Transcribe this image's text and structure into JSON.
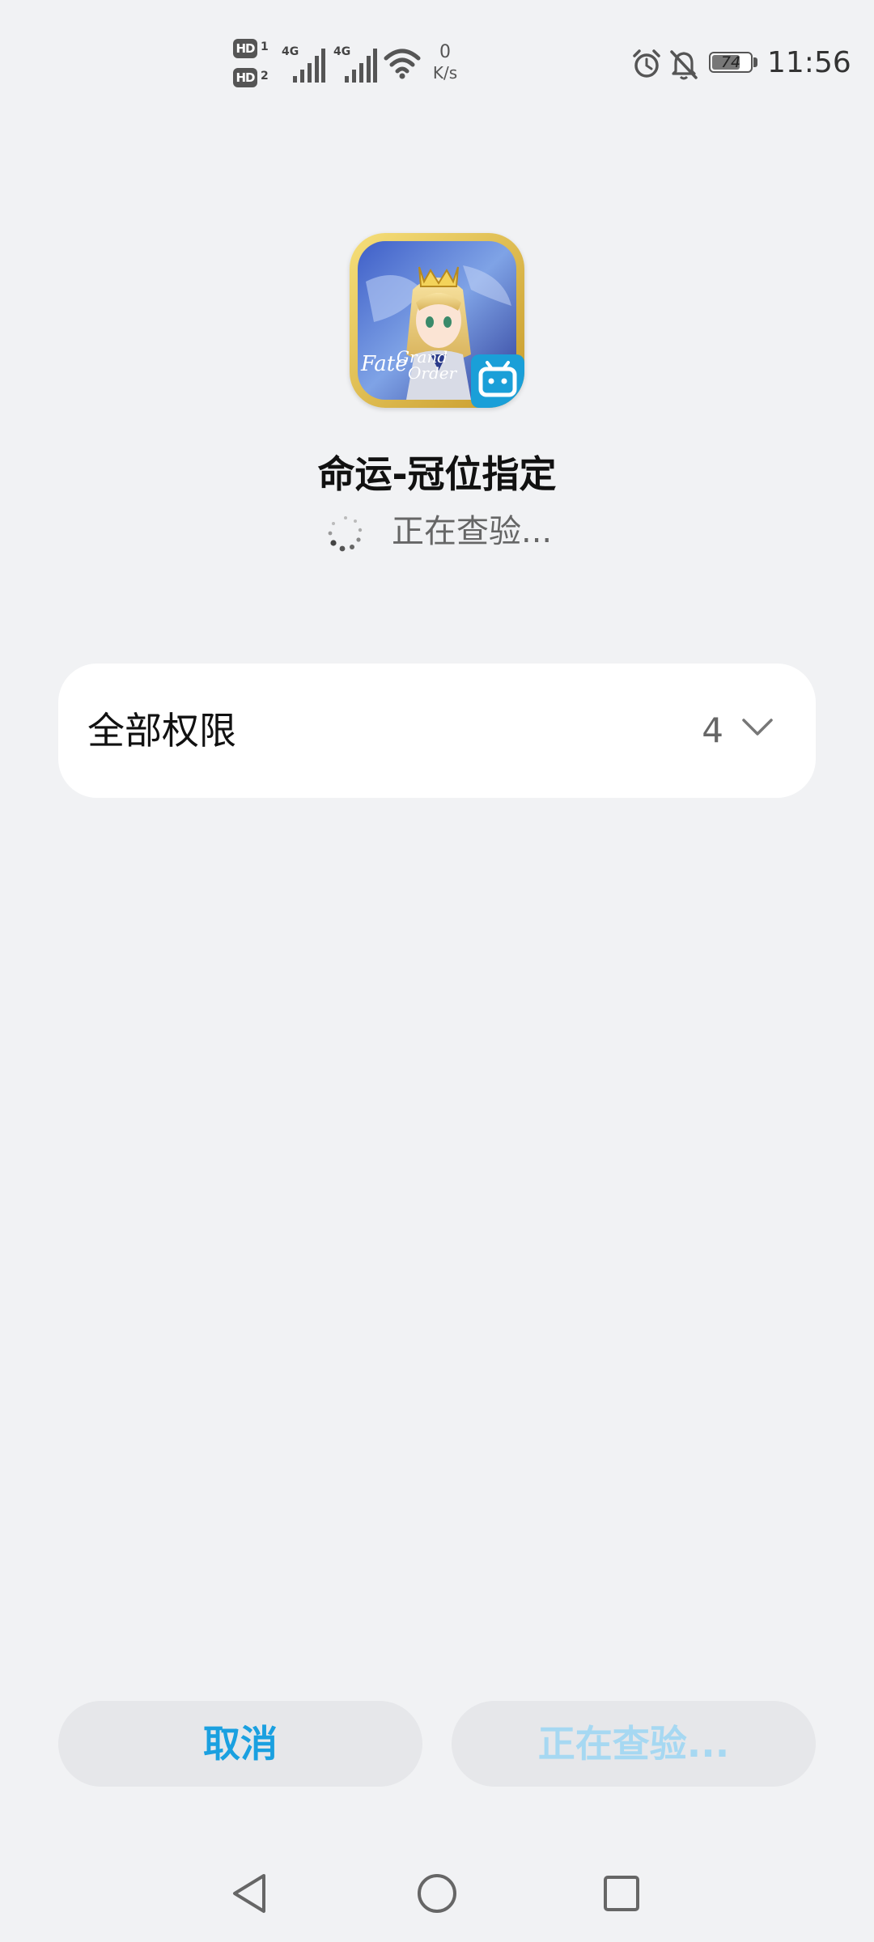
{
  "status_bar": {
    "hd_badges": [
      {
        "label": "HD",
        "slot": "1"
      },
      {
        "label": "HD",
        "slot": "2"
      }
    ],
    "network": [
      {
        "type": "4G",
        "signal_level": 1.0
      },
      {
        "type": "4G",
        "signal_level": 1.0
      }
    ],
    "wifi_icon": "wifi-icon",
    "speed_value": "0",
    "speed_unit": "K/s",
    "alarm_icon": "alarm-icon",
    "notifications_icon": "bell-off-icon",
    "battery_percent": "74",
    "time": "11:56"
  },
  "app": {
    "icon": "fate-grand-order-app-icon",
    "name": "命运-冠位指定",
    "status_text": "正在查验...",
    "status_icon": "loading-spinner-icon"
  },
  "permissions": {
    "title": "全部权限",
    "count": "4",
    "expand_icon": "chevron-down-icon"
  },
  "buttons": {
    "cancel_label": "取消",
    "install_label": "正在查验..."
  },
  "nav_bar": {
    "back_icon": "back-triangle-icon",
    "home_icon": "home-circle-icon",
    "recents_icon": "recents-square-icon"
  },
  "colors": {
    "background": "#f1f2f4",
    "accent": "#1aa0e0",
    "accent_disabled": "#a6d8f2",
    "button_bg": "#e6e7ea",
    "card_bg": "#ffffff"
  }
}
